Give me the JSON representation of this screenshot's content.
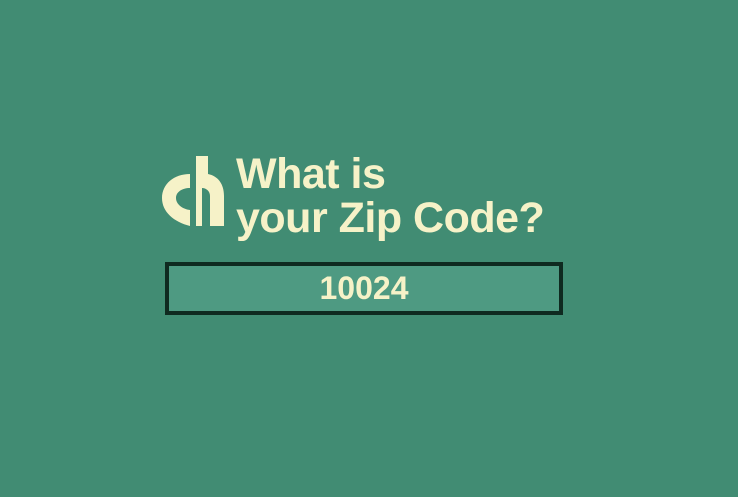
{
  "question": {
    "line1": "What is",
    "line2": "your Zip Code?"
  },
  "zip_input": {
    "value": "10024"
  },
  "logo": {
    "icon": "brand-logo-icon"
  },
  "colors": {
    "background": "#418c73",
    "text": "#f6f2c8",
    "input_background": "#4e9a82",
    "input_border": "#0f2a20"
  }
}
